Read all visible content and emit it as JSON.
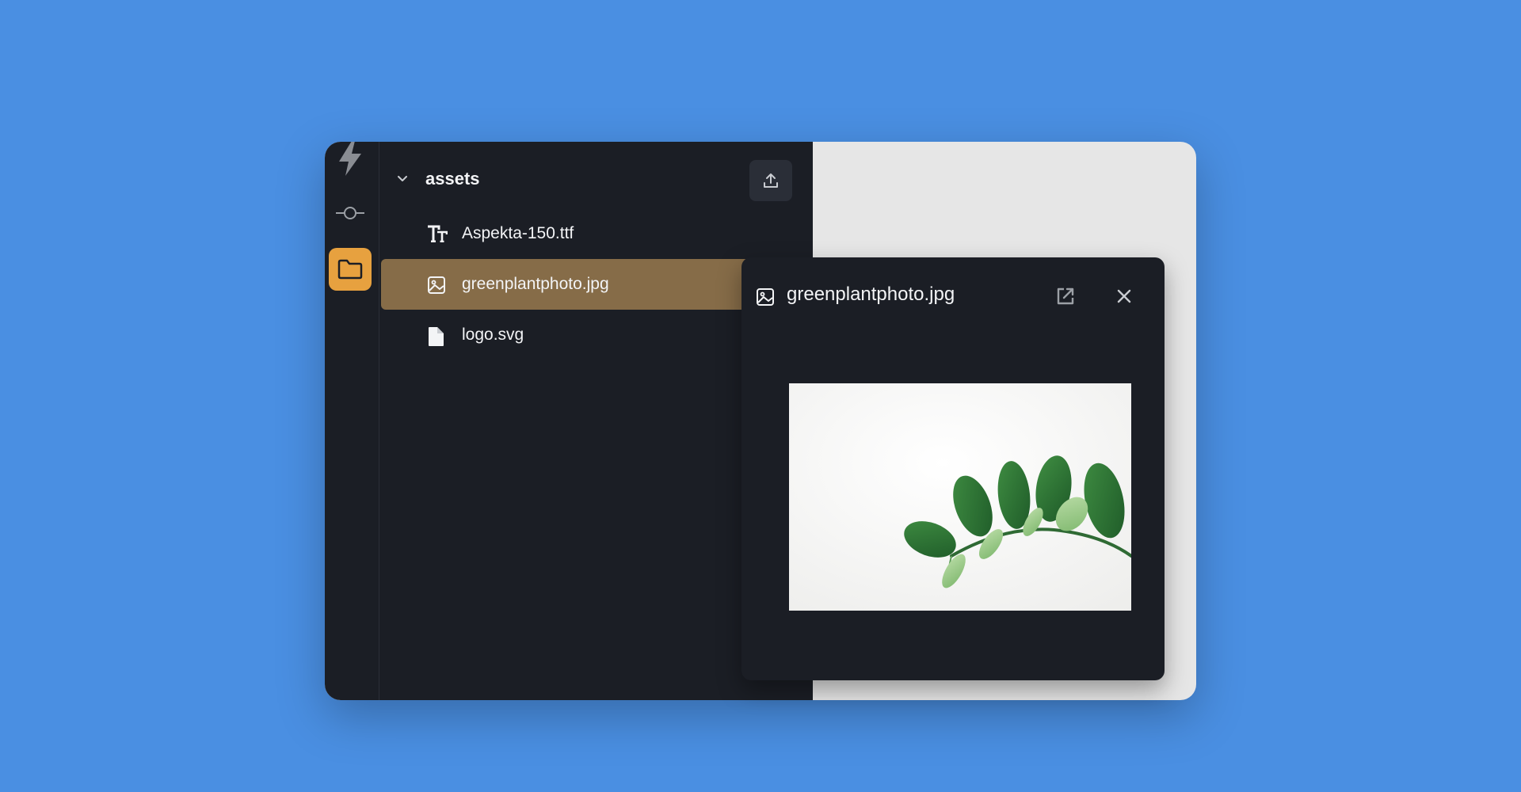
{
  "sidebar": {
    "items": [
      {
        "icon": "lightning-icon"
      },
      {
        "icon": "commit-icon"
      },
      {
        "icon": "folder-icon",
        "active": true
      }
    ]
  },
  "explorer": {
    "folder": {
      "name": "assets",
      "icon": "chevron-down-icon"
    },
    "upload_icon": "upload-icon",
    "files": [
      {
        "name": "Aspekta-150.ttf",
        "icon": "font-icon"
      },
      {
        "name": "greenplantphoto.jpg",
        "icon": "image-icon",
        "selected": true
      },
      {
        "name": "logo.svg",
        "icon": "document-icon"
      }
    ]
  },
  "preview": {
    "title": "greenplantphoto.jpg",
    "title_icon": "image-icon",
    "open_icon": "external-link-icon",
    "close_icon": "close-icon",
    "image": "green-plant-photo"
  },
  "colors": {
    "page_background": "#4a8fe2",
    "panel_background": "#1b1e25",
    "active_accent": "#e7a13f",
    "selected_row": "#866c48"
  }
}
